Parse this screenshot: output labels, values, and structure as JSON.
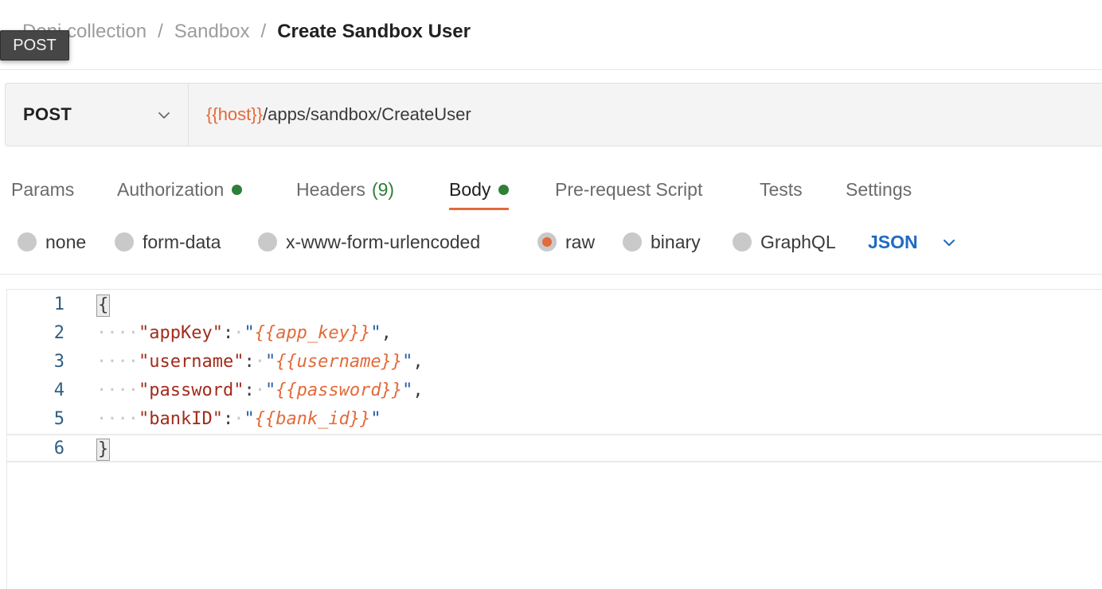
{
  "breadcrumb": {
    "items": [
      "Deni collection",
      "Sandbox"
    ],
    "separator": "/",
    "current": "Create Sandbox User"
  },
  "tooltip": {
    "text": "POST"
  },
  "request": {
    "method": "POST",
    "url_variable": "{{host}}",
    "url_path": "/apps/sandbox/CreateUser"
  },
  "tabs": [
    {
      "label": "Params"
    },
    {
      "label": "Authorization",
      "indicator": "dot"
    },
    {
      "label": "Headers",
      "count": "(9)"
    },
    {
      "label": "Body",
      "indicator": "dot",
      "active": true
    },
    {
      "label": "Pre-request Script"
    },
    {
      "label": "Tests"
    },
    {
      "label": "Settings"
    }
  ],
  "body_types": {
    "options": [
      "none",
      "form-data",
      "x-www-form-urlencoded",
      "raw",
      "binary",
      "GraphQL"
    ],
    "selected": "raw",
    "format": "JSON"
  },
  "editor": {
    "lines": [
      {
        "num": "1",
        "text": "{"
      },
      {
        "num": "2",
        "key": "\"appKey\"",
        "var": "{{app_key}}",
        "trailing": ","
      },
      {
        "num": "3",
        "key": "\"username\"",
        "var": "{{username}}",
        "trailing": ","
      },
      {
        "num": "4",
        "key": "\"password\"",
        "var": "{{password}}",
        "trailing": ","
      },
      {
        "num": "5",
        "key": "\"bankID\"",
        "var": "{{bank_id}}",
        "trailing": ""
      },
      {
        "num": "6",
        "text": "}"
      }
    ]
  },
  "colors": {
    "accent": "#e36a3a",
    "success": "#2e8038",
    "link": "#1f6ac3",
    "json_key": "#a32b1c"
  }
}
